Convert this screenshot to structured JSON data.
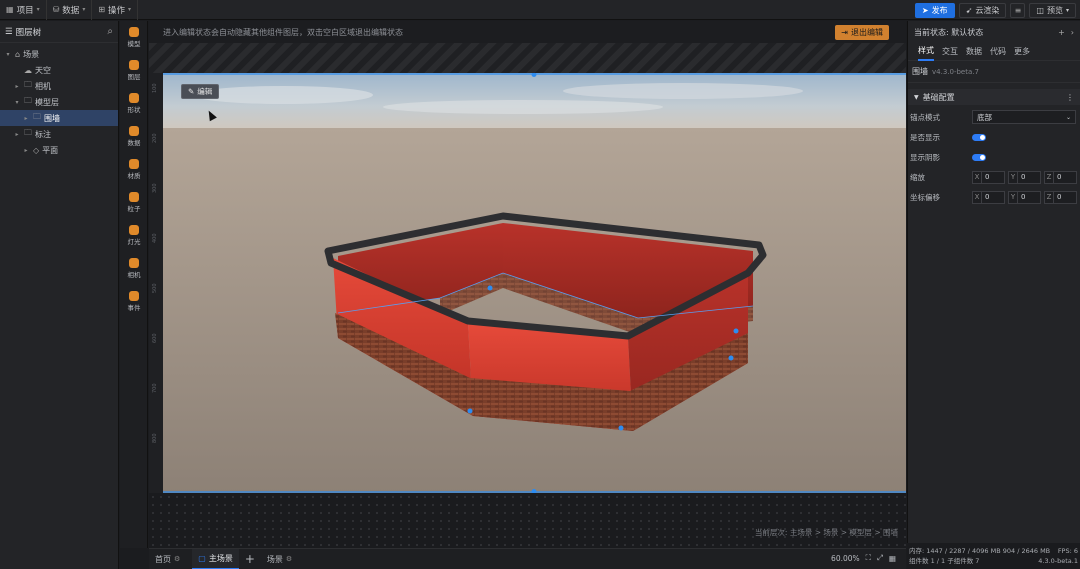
{
  "topbar": {
    "menus": [
      {
        "icon": "grid-icon",
        "label": "项目"
      },
      {
        "icon": "database-icon",
        "label": "数据"
      },
      {
        "icon": "apps-icon",
        "label": "操作"
      }
    ],
    "publish_label": "发布",
    "pair_label": "云渲染",
    "preview_label": "预览"
  },
  "left_panel": {
    "title": "图层树",
    "items": [
      {
        "label": "场景",
        "depth": 0,
        "expanded": true,
        "icon": "scene-icon",
        "selected": false
      },
      {
        "label": "天空",
        "depth": 1,
        "expanded": null,
        "icon": "sky-icon",
        "selected": false
      },
      {
        "label": "相机",
        "depth": 1,
        "expanded": false,
        "icon": "folder-icon",
        "selected": false
      },
      {
        "label": "模型层",
        "depth": 1,
        "expanded": true,
        "icon": "folder-icon",
        "selected": false
      },
      {
        "label": "围墙",
        "depth": 2,
        "expanded": false,
        "icon": "folder-icon",
        "selected": true
      },
      {
        "label": "标注",
        "depth": 1,
        "expanded": false,
        "icon": "folder-icon",
        "selected": false
      },
      {
        "label": "平面",
        "depth": 2,
        "expanded": false,
        "icon": "plane-icon",
        "selected": false
      }
    ]
  },
  "tools": [
    {
      "label": "模型",
      "icon": "model-icon"
    },
    {
      "label": "图层",
      "icon": "layer-icon"
    },
    {
      "label": "形状",
      "icon": "shape-icon"
    },
    {
      "label": "数据",
      "icon": "data-icon"
    },
    {
      "label": "材质",
      "icon": "material-icon"
    },
    {
      "label": "粒子",
      "icon": "particle-icon"
    },
    {
      "label": "灯光",
      "icon": "light-icon"
    },
    {
      "label": "相机",
      "icon": "camera-icon"
    },
    {
      "label": "事件",
      "icon": "event-icon"
    }
  ],
  "viewport": {
    "tip": "进入编辑状态会自动隐藏其他组件图层，双击空白区域退出编辑状态",
    "exit_label": "退出编辑",
    "edit_label": "编辑",
    "breadcrumb": "当前层次: 主场景 > 场景 > 模型层 > 围墙",
    "ruler_ticks": [
      "100",
      "200",
      "300",
      "400",
      "500",
      "600",
      "700",
      "800"
    ]
  },
  "bottom_tabs": [
    {
      "label": "首页",
      "active": false
    },
    {
      "label": "主场景",
      "active": true
    },
    {
      "label": "场景",
      "active": false
    }
  ],
  "zoom": {
    "value": "60.00%"
  },
  "right_panel": {
    "header": "当前状态: 默认状态",
    "tabs": [
      "样式",
      "交互",
      "数据",
      "代码",
      "更多"
    ],
    "active_tab": 0,
    "component": {
      "name": "围墙",
      "version": "v4.3.0-beta.7"
    },
    "section_title": "基础配置",
    "rows": {
      "anchor": {
        "label": "锚点模式",
        "value": "底部"
      },
      "visible": {
        "label": "是否显示",
        "on": true
      },
      "shadow": {
        "label": "显示阴影",
        "on": true
      },
      "scale": {
        "label": "缩放",
        "x": "0",
        "y": "0",
        "z": "0"
      },
      "offset": {
        "label": "坐标偏移",
        "x": "0",
        "y": "0",
        "z": "0"
      }
    }
  },
  "status": {
    "line1": "内存: 1447 / 2287 / 4096 MB  904 / 2646 MB",
    "fps": "FPS: 6",
    "line2": "组件数 1 / 1   子组件数 7",
    "version": "4.3.0-beta.1"
  },
  "colors": {
    "accent": "#2d7cf6",
    "exit": "#d1812f",
    "wall": "#d8372b",
    "brick": "#7a3e2a"
  }
}
